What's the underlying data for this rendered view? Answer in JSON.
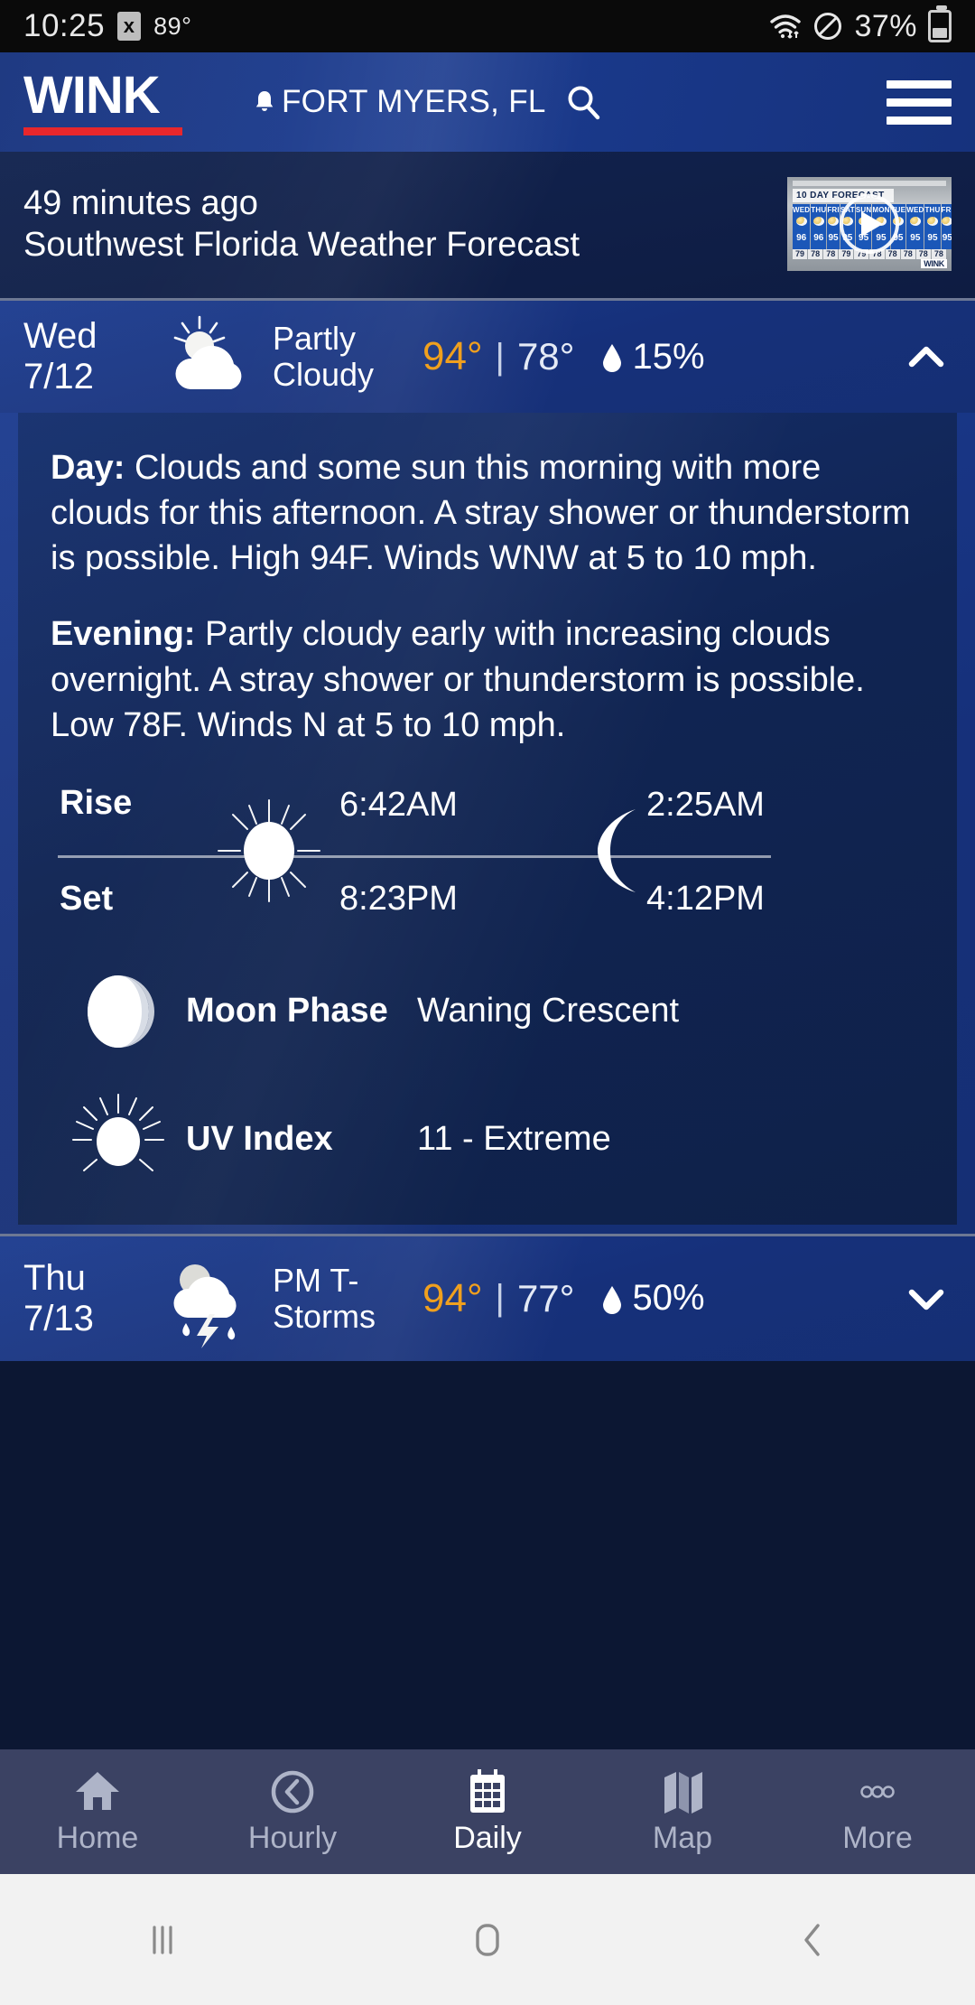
{
  "status_bar": {
    "time": "10:25",
    "sim_icon": "sim-card-icon",
    "temperature": "89°",
    "wifi_icon": "wifi-icon",
    "dnd_icon": "do-not-disturb-icon",
    "battery_percent": "37%",
    "battery_icon": "battery-icon"
  },
  "header": {
    "logo": "WINK",
    "location": "FORT MYERS, FL",
    "bell_icon": "bell-icon",
    "search_icon": "search-icon",
    "menu_icon": "hamburger-menu-icon"
  },
  "promo": {
    "time_ago": "49 minutes ago",
    "title": "Southwest Florida Weather Forecast",
    "play_icon": "play-button-icon",
    "thumbnail": {
      "banner": "10 DAY FORECAST",
      "days": [
        "WED",
        "THU",
        "FRI",
        "SAT",
        "SUN",
        "MON",
        "TUE",
        "WED",
        "THU",
        "FRI"
      ],
      "highs": [
        "96",
        "96",
        "95",
        "95",
        "95",
        "95",
        "95",
        "95",
        "95",
        "95"
      ],
      "lows": [
        "79",
        "78",
        "78",
        "79",
        "79",
        "78",
        "78",
        "78",
        "78",
        "78"
      ],
      "watermark": "WINK"
    }
  },
  "forecast": {
    "expanded_day": {
      "day": "Wed",
      "date": "7/12",
      "condition": "Partly Cloudy",
      "icon": "partly-cloudy-icon",
      "high": "94°",
      "separator": "|",
      "low": "78°",
      "precip_icon": "water-drop-icon",
      "precip": "15%",
      "toggle_icon": "chevron-up-icon",
      "detail": {
        "day_label": "Day:",
        "day_text": "Clouds and some sun this morning with more clouds for this afternoon. A stray shower or thunderstorm is possible. High 94F. Winds WNW at 5 to 10 mph.",
        "evening_label": "Evening:",
        "evening_text": "Partly cloudy early with increasing clouds overnight. A stray shower or thunderstorm is possible. Low 78F. Winds N at 5 to 10 mph.",
        "rise_label": "Rise",
        "set_label": "Set",
        "sun_icon": "sun-icon",
        "moon_icon": "crescent-moon-icon",
        "sunrise": "6:42AM",
        "sunset": "8:23PM",
        "moonrise": "2:25AM",
        "moonset": "4:12PM",
        "moon_phase_icon": "moon-phase-icon",
        "moon_phase_label": "Moon Phase",
        "moon_phase_value": "Waning Crescent",
        "uv_icon": "uv-sun-icon",
        "uv_label": "UV Index",
        "uv_value": "11 - Extreme"
      }
    },
    "next_day": {
      "day": "Thu",
      "date": "7/13",
      "condition": "PM T-Storms",
      "icon": "thunderstorm-icon",
      "high": "94°",
      "separator": "|",
      "low": "77°",
      "precip_icon": "water-drop-icon",
      "precip": "50%",
      "toggle_icon": "chevron-down-icon"
    }
  },
  "tab_bar": {
    "tabs": [
      {
        "label": "Home",
        "icon": "home-icon",
        "active": false
      },
      {
        "label": "Hourly",
        "icon": "clock-icon",
        "active": false
      },
      {
        "label": "Daily",
        "icon": "calendar-icon",
        "active": true
      },
      {
        "label": "Map",
        "icon": "map-icon",
        "active": false
      },
      {
        "label": "More",
        "icon": "ellipsis-icon",
        "active": false
      }
    ]
  },
  "system_nav": {
    "recents_icon": "recents-icon",
    "home_icon": "home-square-icon",
    "back_icon": "back-chevron-icon"
  },
  "colors": {
    "accent_red": "#e8272c",
    "high_temp": "#f0a01e",
    "header_blue": "#1b3b8f",
    "panel_blue": "#102452",
    "tabbar": "#3b4263"
  }
}
